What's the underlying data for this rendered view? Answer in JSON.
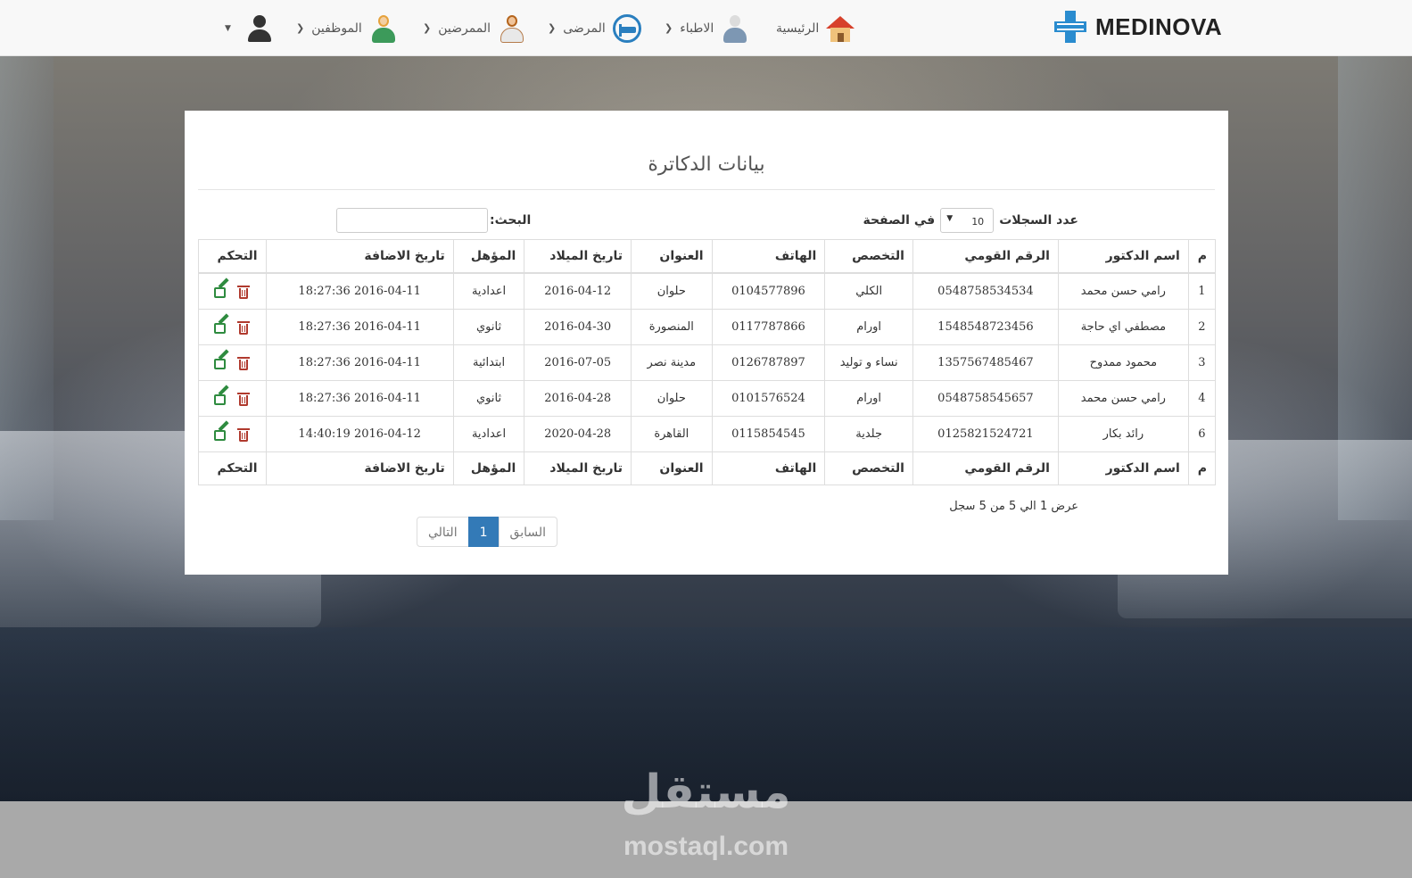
{
  "brand": {
    "name": "MEDINOVA"
  },
  "nav": {
    "home": "الرئيسية",
    "doctors": "الاطباء",
    "patients": "المرضى",
    "nurses": "الممرضين",
    "employees": "الموظفين"
  },
  "panel": {
    "title": "بيانات الدكاترة",
    "length_label_pre": "عدد السجلات",
    "length_value": "10",
    "length_label_post": "في الصفحة",
    "search_label": "البحث:",
    "search_value": ""
  },
  "table": {
    "headers": [
      "م",
      "اسم الدكتور",
      "الرقم القومي",
      "التخصص",
      "الهاتف",
      "العنوان",
      "تاريخ الميلاد",
      "المؤهل",
      "تاريخ الاضافة",
      "التحكم"
    ],
    "rows": [
      [
        "1",
        "رامي حسن محمد",
        "0548758534534",
        "الكلي",
        "0104577896",
        "حلوان",
        "2016-04-12",
        "اعدادية",
        "2016-04-11 18:27:36"
      ],
      [
        "2",
        "مصطفي اي حاجة",
        "1548548723456",
        "اورام",
        "0117787866",
        "المنصورة",
        "2016-04-30",
        "ثانوي",
        "2016-04-11 18:27:36"
      ],
      [
        "3",
        "محمود ممدوح",
        "1357567485467",
        "نساء و توليد",
        "0126787897",
        "مدينة نصر",
        "2016-07-05",
        "ابتدائية",
        "2016-04-11 18:27:36"
      ],
      [
        "4",
        "رامي حسن محمد",
        "0548758545657",
        "اورام",
        "0101576524",
        "حلوان",
        "2016-04-28",
        "ثانوي",
        "2016-04-11 18:27:36"
      ],
      [
        "6",
        "رائد بكار",
        "0125821524721",
        "جلدية",
        "0115854545",
        "القاهرة",
        "2020-04-28",
        "اعدادية",
        "2016-04-12 14:40:19"
      ]
    ]
  },
  "footer": {
    "info": "عرض 1 الي 5 من 5 سجل",
    "prev": "السابق",
    "page": "1",
    "next": "التالي"
  },
  "watermark": {
    "arabic": "مستقل",
    "latin": "mostaql.com"
  },
  "colors": {
    "accent": "#337ab7",
    "brand_icon": "#2a8ccf",
    "edit": "#2e8b3f",
    "delete": "#b03a2e"
  }
}
